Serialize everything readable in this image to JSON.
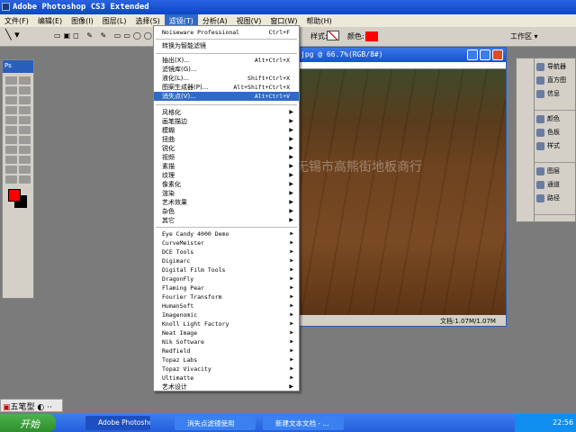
{
  "window": {
    "title": "Adobe Photoshop CS3 Extended"
  },
  "menubar": [
    "文件(F)",
    "编辑(E)",
    "图像(I)",
    "图层(L)",
    "选择(S)",
    "滤镜(T)",
    "分析(A)",
    "视图(V)",
    "窗口(W)",
    "帮助(H)"
  ],
  "options": {
    "style_label": "样式:",
    "color_label": "颜色:",
    "color_value": "#ff0000",
    "workspace": "工作区 ▾"
  },
  "filter_menu": {
    "top": [
      {
        "label": "Noiseware Professional",
        "shortcut": "Ctrl+F"
      }
    ],
    "smart": "转换为智能滤镜",
    "group1": [
      {
        "label": "抽出(X)...",
        "shortcut": "Alt+Ctrl+X"
      },
      {
        "label": "滤镜库(G)...",
        "shortcut": ""
      },
      {
        "label": "液化(L)...",
        "shortcut": "Shift+Ctrl+X"
      },
      {
        "label": "图案生成器(P)...",
        "shortcut": "Alt+Shift+Ctrl+X"
      },
      {
        "label": "消失点(V)...",
        "shortcut": "Alt+Ctrl+V",
        "highlighted": true
      }
    ],
    "builtin": [
      "风格化",
      "画笔描边",
      "模糊",
      "扭曲",
      "锐化",
      "视频",
      "素描",
      "纹理",
      "像素化",
      "渲染",
      "艺术效果",
      "杂色",
      "其它"
    ],
    "plugins": [
      "Eye Candy 4000 Demo",
      "CurveMeister",
      "DCE Tools",
      "Digimarc",
      "Digital Film Tools",
      "DragonFly",
      "Flaming Pear",
      "Fourier Transform",
      "HumanSoft",
      "Imagenomic",
      "Knoll Light Factory",
      "Neat Image",
      "Nik Software",
      "Redfield",
      "Topaz Labs",
      "Topaz Vivacity",
      "Ultimatte",
      "艺术设计"
    ]
  },
  "document": {
    "title": "jpg @ 66.7%(RGB/8#)",
    "status": "文档:1.07M/1.07M",
    "watermark": "无锡市高熊街地板商行"
  },
  "panels": [
    [
      "导航器",
      "直方图",
      "信息"
    ],
    [
      "颜色",
      "色板",
      "样式"
    ],
    [
      "图层",
      "通道",
      "路径"
    ]
  ],
  "toolbox": {
    "header": "Ps",
    "fg_color": "#ff0000",
    "bg_color": "#000000"
  },
  "ime": {
    "label": "五笔型"
  },
  "taskbar": {
    "start": "开始",
    "tasks": [
      "Adobe Photoshop ...",
      "消失点滤镜使用",
      "新建文本文档 - ..."
    ],
    "clock": "22:56"
  }
}
